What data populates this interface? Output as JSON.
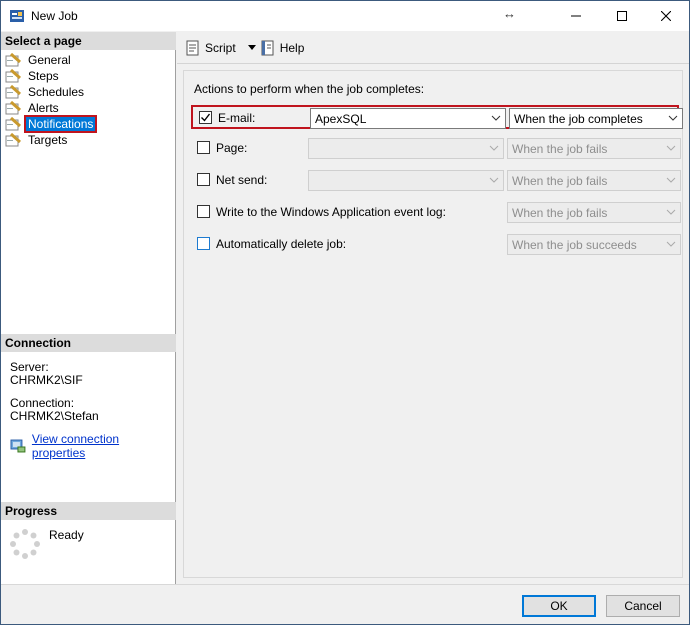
{
  "window": {
    "title": "New Job",
    "resize_glyph": "↔"
  },
  "left": {
    "select_page_header": "Select a page",
    "pages": [
      {
        "label": "General",
        "icon": "wrench-page-icon"
      },
      {
        "label": "Steps",
        "icon": "wrench-page-icon"
      },
      {
        "label": "Schedules",
        "icon": "wrench-page-icon"
      },
      {
        "label": "Alerts",
        "icon": "wrench-page-icon"
      },
      {
        "label": "Notifications",
        "icon": "wrench-page-icon",
        "selected": true
      },
      {
        "label": "Targets",
        "icon": "wrench-page-icon"
      }
    ],
    "connection_header": "Connection",
    "server_label": "Server:",
    "server_value": "CHRMK2\\SIF",
    "connection_label": "Connection:",
    "connection_value": "CHRMK2\\Stefan",
    "view_connection_link": "View connection properties",
    "progress_header": "Progress",
    "progress_status": "Ready"
  },
  "toolbar": {
    "script_label": "Script",
    "help_label": "Help"
  },
  "main": {
    "actions_label": "Actions to perform when the job completes:",
    "rows": [
      {
        "label": "E-mail:",
        "checked": true,
        "operator": "ApexSQL",
        "condition": "When the job completes",
        "enabled": true
      },
      {
        "label": "Page:",
        "checked": false,
        "operator": "",
        "condition": "When the job fails",
        "enabled": false
      },
      {
        "label": "Net send:",
        "checked": false,
        "operator": "",
        "condition": "When the job fails",
        "enabled": false
      },
      {
        "label": "Write to the Windows Application event log:",
        "checked": false,
        "condition": "When the job fails",
        "enabled": false
      },
      {
        "label": "Automatically delete job:",
        "checked": false,
        "condition": "When the job succeeds",
        "enabled": false
      }
    ]
  },
  "buttons": {
    "ok": "OK",
    "cancel": "Cancel"
  },
  "colors": {
    "selection": "#0078d7",
    "highlight_border": "#c0141e",
    "link": "#0033cc"
  }
}
